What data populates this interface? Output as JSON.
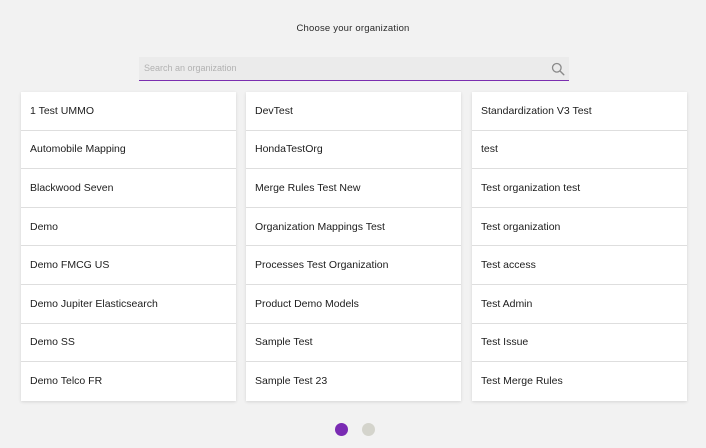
{
  "page": {
    "title": "Choose your organization"
  },
  "search": {
    "placeholder": "Search an organization",
    "value": ""
  },
  "columns": [
    [
      "1 Test UMMO",
      "Automobile Mapping",
      "Blackwood Seven",
      "Demo",
      "Demo FMCG US",
      "Demo Jupiter Elasticsearch",
      "Demo SS",
      "Demo Telco FR"
    ],
    [
      "DevTest",
      "HondaTestOrg",
      "Merge Rules Test New",
      "Organization Mappings Test",
      "Processes Test Organization",
      "Product Demo Models",
      "Sample Test",
      "Sample Test 23"
    ],
    [
      "Standardization V3 Test",
      "test",
      "Test organization test",
      "Test organization",
      "Test access",
      "Test Admin",
      "Test Issue",
      "Test Merge Rules"
    ]
  ],
  "pagination": {
    "pages": 2,
    "current": 1
  },
  "colors": {
    "accent": "#7b2fb0",
    "dot_active": "#7a2bb3",
    "dot_inactive": "#d4d4cc",
    "background": "#f2f2f2"
  }
}
